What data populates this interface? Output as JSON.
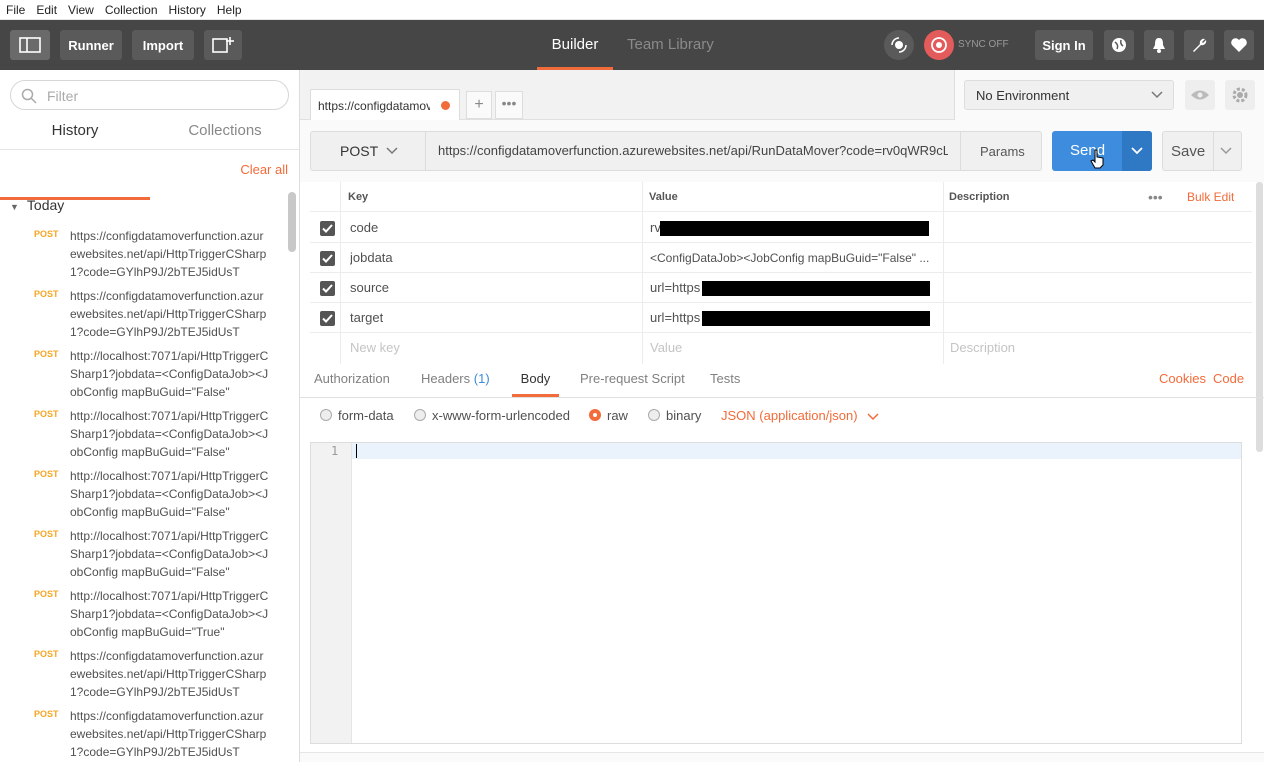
{
  "menu": [
    "File",
    "Edit",
    "View",
    "Collection",
    "History",
    "Help"
  ],
  "toolbar": {
    "runner": "Runner",
    "import": "Import",
    "builder_tab": "Builder",
    "team_library_tab": "Team Library",
    "sync": "SYNC OFF",
    "sign_in": "Sign In"
  },
  "sidebar": {
    "filter_placeholder": "Filter",
    "tabs": [
      "History",
      "Collections"
    ],
    "clear_all": "Clear all",
    "group": "Today",
    "history": [
      {
        "method": "POST",
        "url": "https://configdatamoverfunction.azurewebsites.net/api/HttpTriggerCSharp1?code=GYlhP9J/2bTEJ5idUsT"
      },
      {
        "method": "POST",
        "url": "https://configdatamoverfunction.azurewebsites.net/api/HttpTriggerCSharp1?code=GYlhP9J/2bTEJ5idUsT"
      },
      {
        "method": "POST",
        "url": "http://localhost:7071/api/HttpTriggerCSharp1?jobdata=<ConfigDataJob><JobConfig mapBuGuid=\"False\""
      },
      {
        "method": "POST",
        "url": "http://localhost:7071/api/HttpTriggerCSharp1?jobdata=<ConfigDataJob><JobConfig mapBuGuid=\"False\""
      },
      {
        "method": "POST",
        "url": "http://localhost:7071/api/HttpTriggerCSharp1?jobdata=<ConfigDataJob><JobConfig mapBuGuid=\"False\""
      },
      {
        "method": "POST",
        "url": "http://localhost:7071/api/HttpTriggerCSharp1?jobdata=<ConfigDataJob><JobConfig mapBuGuid=\"False\""
      },
      {
        "method": "POST",
        "url": "http://localhost:7071/api/HttpTriggerCSharp1?jobdata=<ConfigDataJob><JobConfig mapBuGuid=\"True\""
      },
      {
        "method": "POST",
        "url": "https://configdatamoverfunction.azurewebsites.net/api/HttpTriggerCSharp1?code=GYlhP9J/2bTEJ5idUsT"
      },
      {
        "method": "POST",
        "url": "https://configdatamoverfunction.azurewebsites.net/api/HttpTriggerCSharp1?code=GYlhP9J/2bTEJ5idUsT"
      }
    ]
  },
  "request_tab": {
    "title": "https://configdatamov"
  },
  "environment": {
    "selected": "No Environment"
  },
  "request": {
    "method": "POST",
    "url": "https://configdatamoverfunction.azurewebsites.net/api/RunDataMover?code=rv0qWR9cL...",
    "params": "Params",
    "send": "Send",
    "save": "Save"
  },
  "params_table": {
    "headers": {
      "key": "Key",
      "value": "Value",
      "description": "Description",
      "bulk_edit": "Bulk Edit"
    },
    "rows": [
      {
        "key": "code",
        "value": "rv"
      },
      {
        "key": "jobdata",
        "value": "<ConfigDataJob><JobConfig mapBuGuid=\"False\" ..."
      },
      {
        "key": "source",
        "value": "url=https"
      },
      {
        "key": "target",
        "value": "url=https"
      }
    ],
    "new_key_placeholder": "New key",
    "new_value_placeholder": "Value",
    "new_description_placeholder": "Description"
  },
  "subtabs": {
    "authorization": "Authorization",
    "headers": "Headers",
    "headers_count": "(1)",
    "body": "Body",
    "pre_request": "Pre-request Script",
    "tests": "Tests",
    "cookies": "Cookies",
    "code": "Code"
  },
  "body_options": {
    "form_data": "form-data",
    "urlencoded": "x-www-form-urlencoded",
    "raw": "raw",
    "binary": "binary",
    "content_type": "JSON (application/json)"
  },
  "editor": {
    "line_number": "1"
  },
  "colors": {
    "accent": "#f26b3a",
    "send": "#3d8cde",
    "toolbar": "#464646",
    "method_orange": "#f5a623"
  }
}
